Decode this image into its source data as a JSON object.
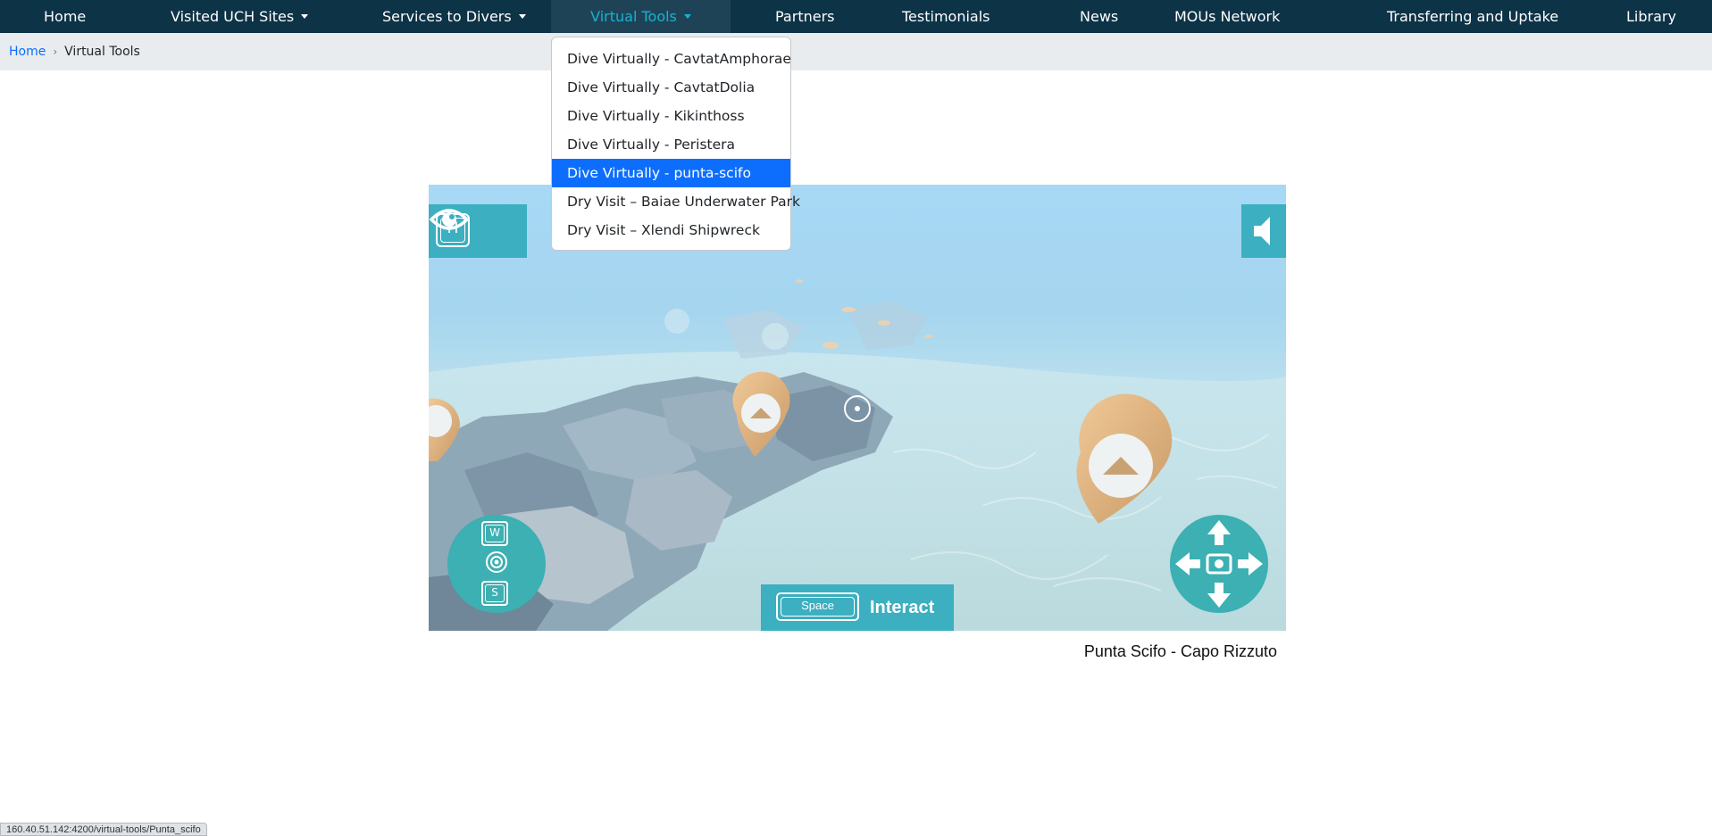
{
  "nav": {
    "items": [
      {
        "label": "Home"
      },
      {
        "label": "Visited UCH Sites"
      },
      {
        "label": "Services to Divers"
      },
      {
        "label": "Virtual Tools"
      },
      {
        "label": "Partners"
      },
      {
        "label": "Testimonials"
      },
      {
        "label": "News"
      },
      {
        "label": "MOUs Network"
      },
      {
        "label": "Transferring and Uptake"
      },
      {
        "label": "Library"
      }
    ],
    "active": "Virtual Tools"
  },
  "breadcrumb": {
    "home": "Home",
    "separator": "›",
    "current": "Virtual Tools"
  },
  "dropdown": {
    "items": [
      {
        "label": "Dive Virtually - CavtatAmphorae"
      },
      {
        "label": "Dive Virtually - CavtatDolia"
      },
      {
        "label": "Dive Virtually - Kikinthoss"
      },
      {
        "label": "Dive Virtually - Peristera"
      },
      {
        "label": "Dive Virtually - punta-scifo"
      },
      {
        "label": "Dry Visit – Baiae Underwater Park"
      },
      {
        "label": "Dry Visit – Xlendi Shipwreck"
      }
    ],
    "selected": "Dive Virtually - punta-scifo"
  },
  "viewer": {
    "key_h": "H",
    "key_w": "W",
    "key_s": "S",
    "key_space": "Space",
    "interact_label": "Interact",
    "caption": "Punta Scifo - Capo Rizzuto"
  },
  "status_bar": {
    "url": "160.40.51.142:4200/virtual-tools/Punta_scifo"
  },
  "colors": {
    "navbar": "#0d3347",
    "accent": "#17b3d1",
    "selected": "#0d6efd",
    "hud": "#3cafc0"
  }
}
